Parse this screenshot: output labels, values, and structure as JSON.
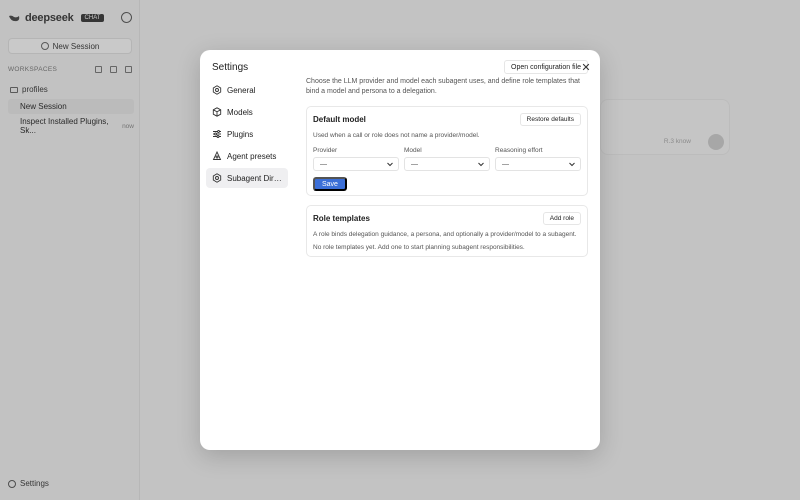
{
  "app": {
    "brand": "deepseek",
    "badge": "CHAT",
    "new_session": "New Session",
    "workspaces_label": "WORKSPACES",
    "folder": "profiles",
    "sessions": [
      {
        "title": "New Session",
        "time": ""
      },
      {
        "title": "Inspect Installed Plugins, Sk...",
        "time": "now"
      }
    ],
    "settings_link": "Settings",
    "composer_hint": "R.3 know"
  },
  "modal": {
    "title": "Settings",
    "open_config": "Open configuration file",
    "nav": [
      {
        "label": "General",
        "icon": "hexagon-gear-icon"
      },
      {
        "label": "Models",
        "icon": "cube-icon"
      },
      {
        "label": "Plugins",
        "icon": "sliders-icon"
      },
      {
        "label": "Agent presets",
        "icon": "robot-icon"
      },
      {
        "label": "Subagent Directory",
        "icon": "hexagon-gear-icon"
      }
    ],
    "intro": "Choose the LLM provider and model each subagent uses, and define role templates that bind a model and persona to a delegation.",
    "default_model": {
      "title": "Default model",
      "restore": "Restore defaults",
      "desc": "Used when a call or role does not name a provider/model.",
      "provider_label": "Provider",
      "model_label": "Model",
      "effort_label": "Reasoning effort",
      "provider_value": "—",
      "model_value": "—",
      "effort_value": "—",
      "save": "Save"
    },
    "role_templates": {
      "title": "Role templates",
      "add": "Add role",
      "desc": "A role binds delegation guidance, a persona, and optionally a provider/model to a subagent.",
      "empty": "No role templates yet. Add one to start planning subagent responsibilities."
    }
  }
}
